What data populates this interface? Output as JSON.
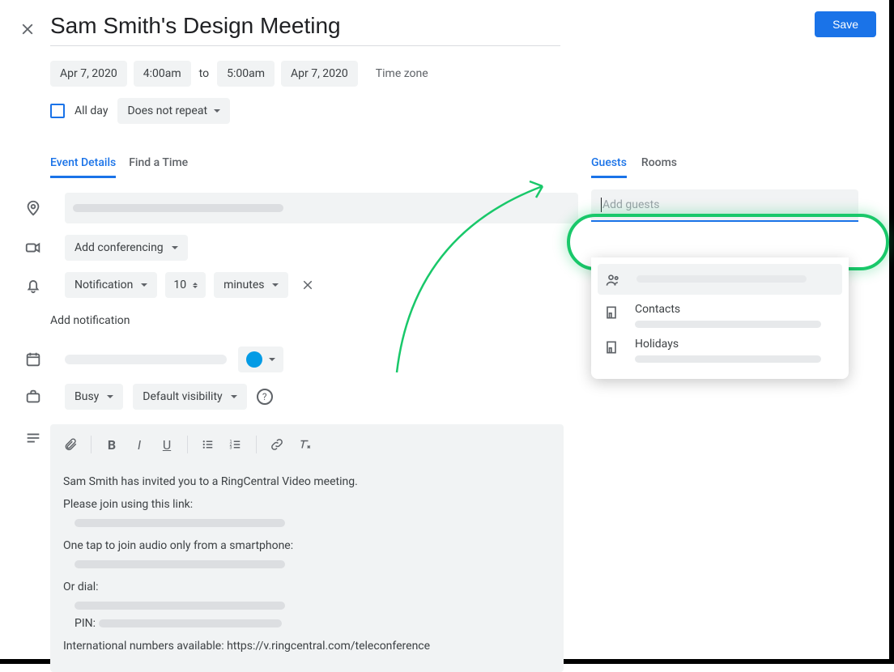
{
  "header": {
    "title": "Sam Smith's Design Meeting",
    "save_label": "Save"
  },
  "datetime": {
    "start_date": "Apr 7, 2020",
    "start_time": "4:00am",
    "to": "to",
    "end_time": "5:00am",
    "end_date": "Apr 7, 2020",
    "timezone_label": "Time zone"
  },
  "options": {
    "allday_label": "All day",
    "repeat_label": "Does not repeat"
  },
  "tabs": {
    "details": "Event Details",
    "find_time": "Find a Time"
  },
  "right_tabs": {
    "guests": "Guests",
    "rooms": "Rooms"
  },
  "conferencing": {
    "label": "Add conferencing"
  },
  "notification": {
    "type": "Notification",
    "value": "10",
    "unit": "minutes",
    "add_label": "Add notification"
  },
  "busy": {
    "busy_label": "Busy",
    "visibility_label": "Default visibility"
  },
  "guests": {
    "placeholder": "Add guests",
    "suggestions": [
      {
        "label": ""
      },
      {
        "label": "Contacts"
      },
      {
        "label": "Holidays"
      }
    ]
  },
  "description": {
    "line1": "Sam Smith has invited you to a RingCentral Video meeting.",
    "line2": "Please join using this link:",
    "line3": "One tap to join audio only from a smartphone:",
    "line4": "Or dial:",
    "pin_label": "PIN:",
    "intl": "International numbers available: https://v.ringcentral.com/teleconference"
  },
  "colors": {
    "event_color": "#039be5"
  }
}
